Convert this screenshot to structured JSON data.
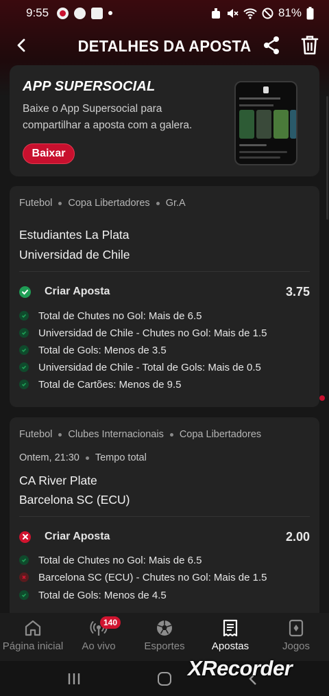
{
  "status_bar": {
    "time": "9:55",
    "battery": "81%"
  },
  "header": {
    "title": "DETALHES DA APOSTA",
    "back_icon": "chevron-left-icon",
    "share_icon": "share-icon",
    "delete_icon": "trash-icon"
  },
  "promo": {
    "title": "APP SUPERSOCIAL",
    "text": "Baixe o App Supersocial para compartilhar a aposta com a galera.",
    "button": "Baixar"
  },
  "bets": [
    {
      "sport": "Futebol",
      "competition": "Copa Libertadores",
      "group": "Gr.A",
      "team_home": "Estudiantes La Plata",
      "team_away": "Universidad de Chile",
      "bet_label": "Criar Aposta",
      "odds": "3.75",
      "status": "won",
      "selections": [
        {
          "text": "Total de Chutes no Gol: Mais de 6.5",
          "status": "won"
        },
        {
          "text": "Universidad de Chile - Chutes no Gol: Mais de 1.5",
          "status": "won"
        },
        {
          "text": "Total de Gols: Menos de 3.5",
          "status": "won"
        },
        {
          "text": "Universidad de Chile - Total de Gols: Mais de 0.5",
          "status": "won"
        },
        {
          "text": "Total de Cartões: Menos de 9.5",
          "status": "won"
        }
      ]
    },
    {
      "sport": "Futebol",
      "competition": "Clubes Internacionais",
      "group": "Copa Libertadores",
      "datetime": "Ontem, 21:30",
      "period": "Tempo total",
      "team_home": "CA River Plate",
      "team_away": "Barcelona SC (ECU)",
      "bet_label": "Criar Aposta",
      "odds": "2.00",
      "status": "lost",
      "selections": [
        {
          "text": "Total de Chutes no Gol: Mais de 6.5",
          "status": "won"
        },
        {
          "text": "Barcelona SC (ECU) - Chutes no Gol: Mais de 1.5",
          "status": "lost"
        },
        {
          "text": "Total de Gols: Menos de 4.5",
          "status": "won"
        }
      ]
    }
  ],
  "bottom_nav": [
    {
      "label": "Página inicial",
      "icon": "home-icon",
      "active": false
    },
    {
      "label": "Ao vivo",
      "icon": "live-icon",
      "badge": "140",
      "active": false
    },
    {
      "label": "Esportes",
      "icon": "soccer-ball-icon",
      "active": false
    },
    {
      "label": "Apostas",
      "icon": "bet-slip-icon",
      "active": true
    },
    {
      "label": "Jogos",
      "icon": "cards-icon",
      "active": false
    }
  ],
  "watermark": "XRecorder",
  "colors": {
    "accent": "#c8102e",
    "won": "#1f9d55",
    "lost": "#d0142f",
    "card": "#232323"
  }
}
